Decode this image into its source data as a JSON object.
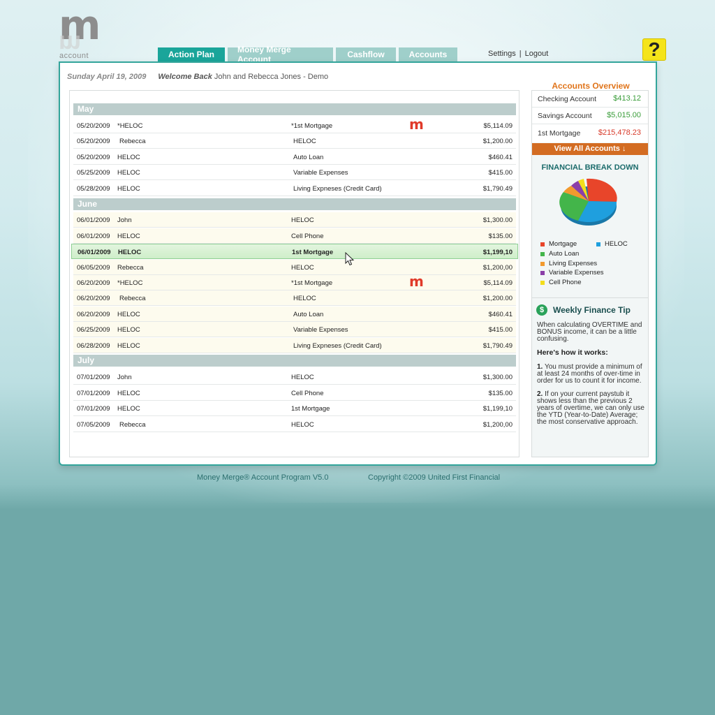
{
  "logo": {
    "mark": "m",
    "text": "account"
  },
  "tabs": [
    {
      "label": "Action Plan",
      "active": true
    },
    {
      "label": "Money Merge Account",
      "active": false
    },
    {
      "label": "Cashflow",
      "active": false
    },
    {
      "label": "Accounts",
      "active": false
    }
  ],
  "toplinks": {
    "settings": "Settings",
    "separator": "|",
    "logout": "Logout"
  },
  "help": {
    "label": "?"
  },
  "header": {
    "date": "Sunday April 19, 2009",
    "welcome": "Welcome Back",
    "user": "John and Rebecca Jones - Demo"
  },
  "plan": {
    "mma_mark": "m",
    "months": [
      "May",
      "June",
      "July"
    ],
    "rows": [
      {
        "date": "05/20/2009",
        "from": "*HELOC",
        "to": "*1st Mortgage",
        "amount": "$5,114.09",
        "mma": true
      },
      {
        "date": "05/20/2009",
        "from": "Rebecca",
        "to": "HELOC",
        "amount": "$1,200.00"
      },
      {
        "date": "05/20/2009",
        "from": "HELOC",
        "to": "Auto Loan",
        "amount": "$460.41"
      },
      {
        "date": "05/25/2009",
        "from": "HELOC",
        "to": "Variable Expenses",
        "amount": "$415.00"
      },
      {
        "date": "05/28/2009",
        "from": "HELOC",
        "to": "Living Expneses (Credit Card)",
        "amount": "$1,790.49"
      },
      {
        "date": "06/01/2009",
        "from": "John",
        "to": "HELOC",
        "amount": "$1,300.00"
      },
      {
        "date": "06/01/2009",
        "from": "HELOC",
        "to": "Cell Phone",
        "amount": "$135.00"
      },
      {
        "date": "06/01/2009",
        "from": "HELOC",
        "to": "1st Mortgage",
        "amount": "$1,199,10",
        "selected": true
      },
      {
        "date": "06/05/2009",
        "from": "Rebecca",
        "to": "HELOC",
        "amount": "$1,200,00"
      },
      {
        "date": "06/20/2009",
        "from": "*HELOC",
        "to": "*1st Mortgage",
        "amount": "$5,114.09",
        "mma": true
      },
      {
        "date": "06/20/2009",
        "from": "Rebecca",
        "to": "HELOC",
        "amount": "$1,200.00"
      },
      {
        "date": "06/20/2009",
        "from": "HELOC",
        "to": "Auto Loan",
        "amount": "$460.41"
      },
      {
        "date": "06/25/2009",
        "from": "HELOC",
        "to": "Variable Expenses",
        "amount": "$415.00"
      },
      {
        "date": "06/28/2009",
        "from": "HELOC",
        "to": "Living Expneses (Credit Card)",
        "amount": "$1,790.49"
      },
      {
        "date": "07/01/2009",
        "from": "John",
        "to": "HELOC",
        "amount": "$1,300.00"
      },
      {
        "date": "07/01/2009",
        "from": "HELOC",
        "to": "Cell Phone",
        "amount": "$135.00"
      },
      {
        "date": "07/01/2009",
        "from": "HELOC",
        "to": "1st Mortgage",
        "amount": "$1,199,10"
      },
      {
        "date": "07/05/2009",
        "from": "Rebecca",
        "to": "HELOC",
        "amount": "$1,200,00"
      }
    ]
  },
  "accounts_overview": {
    "title": "Accounts Overview",
    "accounts": [
      {
        "name": "Checking Account",
        "value": "$413.12"
      },
      {
        "name": "Savings Account",
        "value": "$5,015.00"
      },
      {
        "name": "1st Mortgage",
        "value": "$215,478.23"
      }
    ],
    "view_all": "View All Accounts ↓"
  },
  "breakdown": {
    "title": "FINANCIAL BREAK DOWN",
    "legend": [
      {
        "label": "Mortgage",
        "color": "#e8452a"
      },
      {
        "label": "HELOC",
        "color": "#1f9fde"
      },
      {
        "label": "Auto Loan",
        "color": "#43b54a"
      },
      {
        "label": "Living Expenses",
        "color": "#f29a2e"
      },
      {
        "label": "Variable Expenses",
        "color": "#8b3fa8"
      },
      {
        "label": "Cell Phone",
        "color": "#f3dd1b"
      }
    ]
  },
  "tip": {
    "icon": "$",
    "title": "Weekly Finance Tip",
    "intro": "When calculating OVERTIME and BONUS income, it can be a little confusing.",
    "how": "Here's how it works:",
    "p1_num": "1.",
    "p1": "You must provide a minimum of at least 24 months of over-time in order for us to count it for income.",
    "p2_num": "2.",
    "p2": "If on your current paystub it shows less than the previous 2 years of overtime, we can only use the YTD (Year-to-Date) Average; the most conservative approach."
  },
  "footer": {
    "program": "Money Merge® Account Program V5.0",
    "copyright": "Copyright ©2009 United First Financial"
  }
}
